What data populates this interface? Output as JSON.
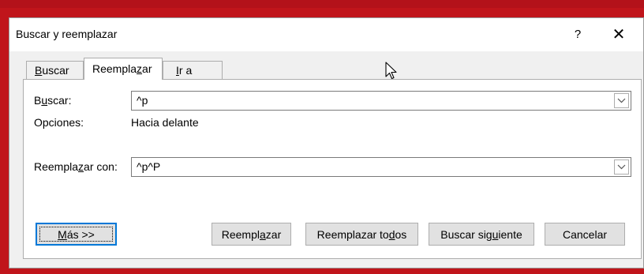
{
  "dialog": {
    "title": "Buscar y reemplazar",
    "help_label": "?",
    "close_label": "✕"
  },
  "tabs": [
    {
      "pre": "",
      "key": "B",
      "post": "uscar"
    },
    {
      "pre": "Reempla",
      "key": "z",
      "post": "ar"
    },
    {
      "pre": "",
      "key": "I",
      "post": "r a"
    }
  ],
  "find": {
    "label_pre": "B",
    "label_key": "u",
    "label_post": "scar:",
    "value": "^p"
  },
  "options": {
    "label": "Opciones:",
    "value": "Hacia delante"
  },
  "replace": {
    "label_pre": "Reempla",
    "label_key": "z",
    "label_post": "ar con:",
    "value": "^p^P"
  },
  "buttons": {
    "more": {
      "pre": "",
      "key": "M",
      "post": "ás >>"
    },
    "replace": {
      "pre": "Reempl",
      "key": "a",
      "post": "zar"
    },
    "replace_all": {
      "pre": "Reemplazar to",
      "key": "d",
      "post": "os"
    },
    "find_next": {
      "pre": "Buscar sig",
      "key": "u",
      "post": "iente"
    },
    "cancel": "Cancelar"
  },
  "icons": {
    "dropdown": "chevron-down-icon",
    "cursor": "mouse-pointer-icon"
  }
}
